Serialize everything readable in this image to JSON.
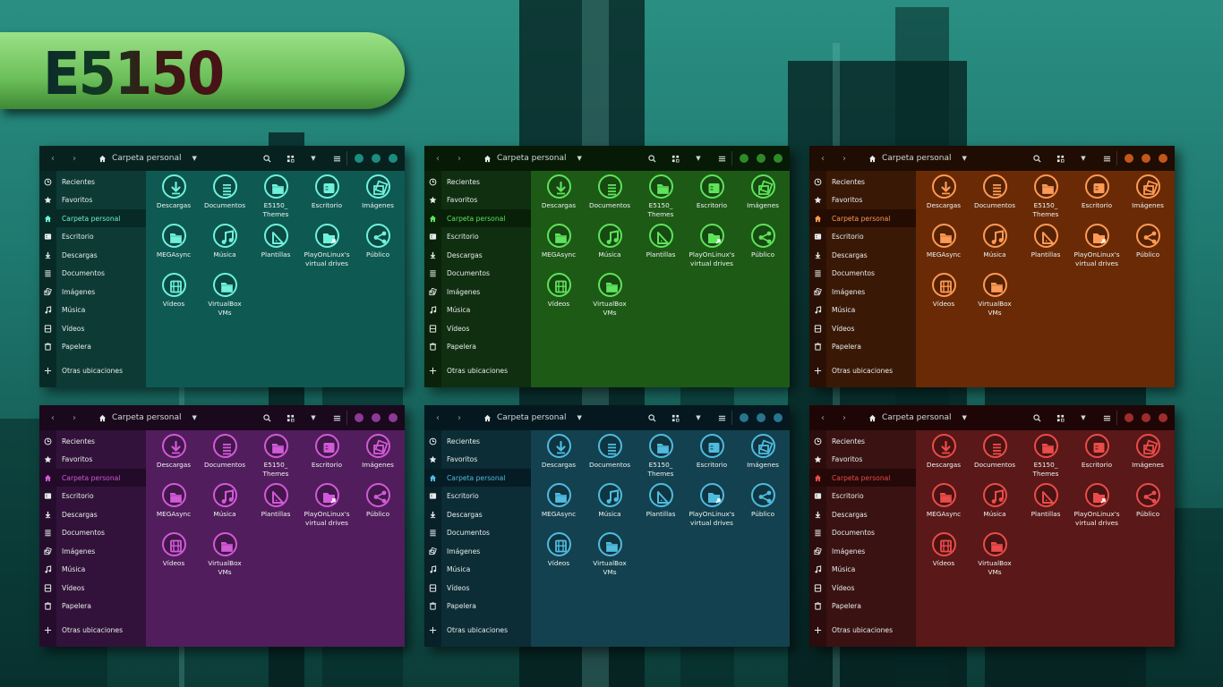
{
  "banner": {
    "title": "E5150"
  },
  "common": {
    "location": "Carpeta personal",
    "sidebar": [
      "Recientes",
      "Favoritos",
      "Carpeta personal",
      "Escritorio",
      "Descargas",
      "Documentos",
      "Imágenes",
      "Música",
      "Vídeos",
      "Papelera"
    ],
    "other_locations": "Otras ubicaciones",
    "folders": [
      {
        "label": [
          "Descargas"
        ],
        "icon": "download-icon"
      },
      {
        "label": [
          "Documentos"
        ],
        "icon": "documents-icon"
      },
      {
        "label": [
          "E5150_",
          "Themes"
        ],
        "icon": "folder-icon"
      },
      {
        "label": [
          "Escritorio"
        ],
        "icon": "desktop-icon"
      },
      {
        "label": [
          "Imágenes"
        ],
        "icon": "images-icon"
      },
      {
        "label": [
          "MEGAsync"
        ],
        "icon": "folder-icon"
      },
      {
        "label": [
          "Música"
        ],
        "icon": "music-icon"
      },
      {
        "label": [
          "Plantillas"
        ],
        "icon": "templates-icon"
      },
      {
        "label": [
          "PlayOnLinux's",
          "virtual drives"
        ],
        "icon": "folder-link-icon"
      },
      {
        "label": [
          "Público"
        ],
        "icon": "share-icon"
      },
      {
        "label": [
          "Vídeos"
        ],
        "icon": "videos-icon"
      },
      {
        "label": [
          "VirtualBox",
          "VMs"
        ],
        "icon": "folder-icon"
      }
    ]
  },
  "themes": [
    {
      "name": "teal",
      "accent": "#6ff2dc",
      "header": "#07211f",
      "sidebar": "#0d3a35",
      "strip": "#082a26",
      "main": "#0e5a52",
      "selected": "#072a26",
      "dots": [
        "#1c8c80",
        "#1c8c80",
        "#1c8c80"
      ]
    },
    {
      "name": "green",
      "accent": "#5ee35a",
      "header": "#061a06",
      "sidebar": "#102e10",
      "strip": "#0a220a",
      "main": "#1d5a16",
      "selected": "#082008",
      "dots": [
        "#2f8a26",
        "#2f8a26",
        "#2f8a26"
      ]
    },
    {
      "name": "orange",
      "accent": "#ff9a55",
      "header": "#1f0c02",
      "sidebar": "#3a1806",
      "strip": "#2a1004",
      "main": "#6a2a06",
      "selected": "#240c02",
      "dots": [
        "#c2561c",
        "#c2561c",
        "#c2561c"
      ]
    },
    {
      "name": "purple",
      "accent": "#d25ad8",
      "header": "#1a081c",
      "sidebar": "#32123a",
      "strip": "#260c2c",
      "main": "#521d5c",
      "selected": "#220a28",
      "dots": [
        "#8c3a94",
        "#8c3a94",
        "#8c3a94"
      ]
    },
    {
      "name": "blue",
      "accent": "#4fbbe0",
      "header": "#051820",
      "sidebar": "#0c2c36",
      "strip": "#082028",
      "main": "#13414f",
      "selected": "#061c24",
      "dots": [
        "#2a7490",
        "#2a7490",
        "#2a7490"
      ]
    },
    {
      "name": "red",
      "accent": "#ea4c4a",
      "header": "#1e0606",
      "sidebar": "#3a1212",
      "strip": "#2c0c0c",
      "main": "#5a1818",
      "selected": "#250808",
      "dots": [
        "#a02c2a",
        "#a02c2a",
        "#a02c2a"
      ]
    }
  ]
}
